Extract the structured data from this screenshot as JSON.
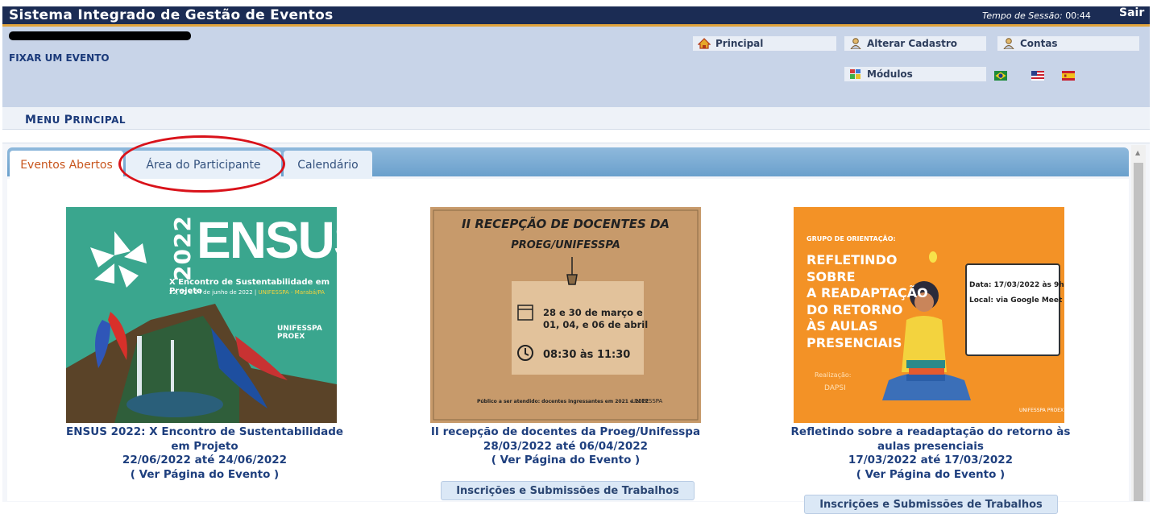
{
  "topbar": {
    "title": "Sistema Integrado de Gestão de Eventos",
    "session_label": "Tempo de Sessão: ",
    "session_time": "00:44",
    "logout": "Sair"
  },
  "header": {
    "fix_event": "FIXAR UM EVENTO",
    "buttons": {
      "principal": "Principal",
      "alterar": "Alterar Cadastro",
      "contas": "Contas",
      "modulos": "Módulos"
    },
    "flags": [
      "brazil-flag-icon",
      "usa-flag-icon",
      "spain-flag-icon"
    ]
  },
  "menu": {
    "first_big": "M",
    "rest": "ENU ",
    "second_big": "P",
    "rest2": "RINCIPAL"
  },
  "tabs": [
    {
      "label": "Eventos Abertos",
      "active": true
    },
    {
      "label": "Área do Participante",
      "active": false
    },
    {
      "label": "Calendário",
      "active": false
    }
  ],
  "events": [
    {
      "title": "ENSUS 2022: X Encontro de Sustentabilidade em Projeto",
      "dates": "22/06/2022 até 24/06/2022",
      "link": "( Ver Página do Evento )",
      "image": {
        "year": "2022",
        "name": "ENSUS",
        "subtitle": "X Encontro de Sustentabilidade em Projeto",
        "date_line": "22, 23 e 24 de junho de 2022 | ",
        "place": "UNIFESSPA - Marabá/PA",
        "logo": "UNIFESSPA PROEX"
      }
    },
    {
      "title": "II recepção de docentes da Proeg/Unifesspa",
      "dates": "28/03/2022 até 06/04/2022",
      "link": "( Ver Página do Evento )",
      "button": "Inscrições e Submissões de Trabalhos",
      "image": {
        "line1": "II RECEPÇÃO DE DOCENTES DA",
        "line2": "PROEG/UNIFESSPA",
        "dates_a": "28 e 30 de março e",
        "dates_b": "01, 04, e 06 de abril",
        "time": "08:30 às 11:30",
        "footer": "Público a ser atendido: docentes ingressantes em 2021 e 2022",
        "logo": "UNIFESSPA"
      }
    },
    {
      "title": "Refletindo sobre a readaptação do retorno às aulas presenciais",
      "dates": "17/03/2022 até 17/03/2022",
      "link": "( Ver Página do Evento )",
      "button": "Inscrições e Submissões de Trabalhos",
      "image": {
        "group": "GRUPO DE ORIENTAÇÃO:",
        "lines": [
          "REFLETINDO",
          "SOBRE",
          "A READAPTAÇÃO",
          "DO RETORNO",
          "ÀS AULAS",
          "PRESENCIAIS"
        ],
        "box_date": "Data: 17/03/2022 às 9h",
        "box_place": "Local: via Google Meet",
        "realizacao": "Realização:",
        "org": "DAPSI",
        "logo": "UNIFESSPA PROEX"
      }
    }
  ]
}
